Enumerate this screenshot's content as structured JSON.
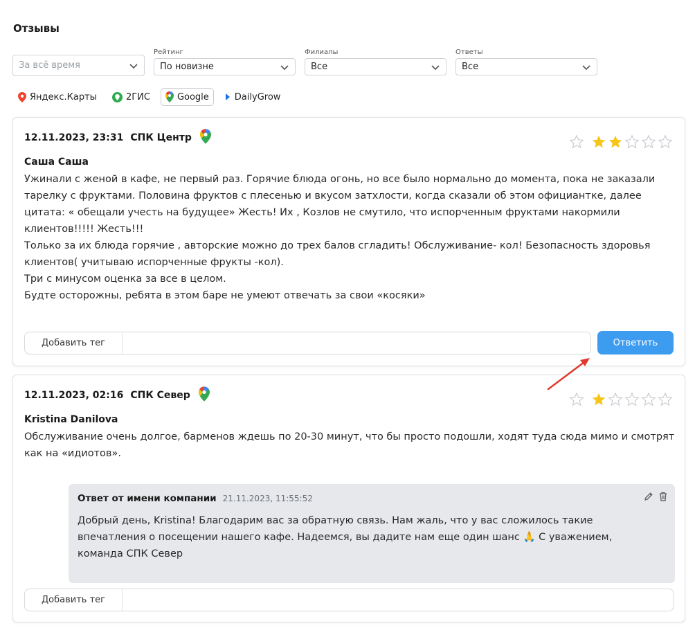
{
  "page": {
    "title": "Отзывы"
  },
  "filters": {
    "period": {
      "value": "За всё время"
    },
    "rating": {
      "label": "Рейтинг",
      "value": "По новизне"
    },
    "branches": {
      "label": "Филиалы",
      "value": "Все"
    },
    "answers": {
      "label": "Ответы",
      "value": "Все"
    }
  },
  "sources": [
    {
      "label": "Яндекс.Карты",
      "icon": "yandex-pin-icon",
      "active": false
    },
    {
      "label": "2ГИС",
      "icon": "2gis-icon",
      "active": false
    },
    {
      "label": "Google",
      "icon": "google-maps-icon",
      "active": true
    },
    {
      "label": "DailyGrow",
      "icon": "dailygrow-icon",
      "active": false
    }
  ],
  "reviews": [
    {
      "datetime": "12.11.2023, 23:31",
      "branch": "СПК Центр",
      "source_icon": "google-maps-icon",
      "rating": 2,
      "author": "Саша Саша",
      "text": "Ужинали с женой в кафе, не первый раз. Горячие блюда огонь, но все было нормально до момента, пока не заказали тарелку с фруктами. Половина фруктов с плесенью и вкусом затхлости, когда сказали об этом официантке, далее цитата: « обещали учесть на будущее» Жесть! Их , Козлов не смутило, что испорченным фруктами накормили клиентов!!!!! Жесть!!!\nТолько за их блюда горячие , авторские можно до трех балов сгладить! Обслуживание- кол! Безопасность здоровья клиентов( учитываю испорченные фрукты -кол).\nТри с минусом оценка за все в целом.\nБудте осторожны, ребята в этом баре не умеют отвечать за свои «косяки»",
      "add_tag_label": "Добавить тег",
      "reply_label": "Ответить"
    },
    {
      "datetime": "12.11.2023, 02:16",
      "branch": "СПК Север",
      "source_icon": "google-maps-icon",
      "rating": 1,
      "author": "Kristina Danilova",
      "text": "Обслуживание очень долгое, барменов ждешь по 20-30 минут, что бы просто подошли, ходят туда сюда мимо и смотрят как на «идиотов».",
      "reply": {
        "title": "Ответ от имени компании",
        "date": "21.11.2023, 11:55:52",
        "text": "Добрый день, Kristina! Благодарим вас за обратную связь. Нам жаль, что у вас сложилось такие впечатления о посещении нашего кафе. Надеемся, вы дадите нам еще один шанс 🙏 С уважением, команда СПК Север"
      },
      "add_tag_label": "Добавить тег"
    }
  ],
  "colors": {
    "star_filled": "#f5c518",
    "star_empty": "#c9ccd1",
    "primary_button": "#3d9bf0",
    "reply_bg": "#e6e8ec",
    "annotation_arrow": "#e0392f"
  }
}
